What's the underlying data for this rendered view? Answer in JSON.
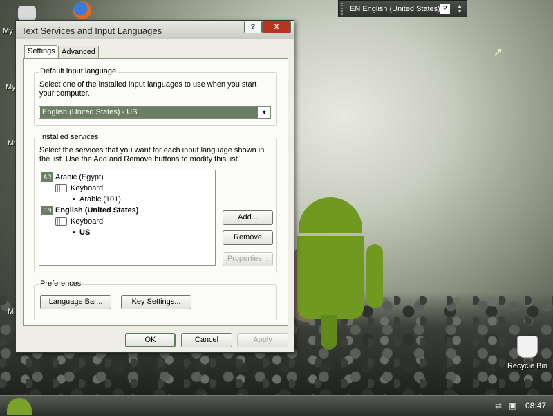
{
  "desktop": {
    "left_labels": [
      "My",
      "My",
      "My",
      "Mi"
    ],
    "recycle_bin": "Recycle Bin"
  },
  "language_bar": {
    "language": "EN English (United States)",
    "help": "?"
  },
  "dialog": {
    "title": "Text Services and Input Languages",
    "help_button": "?",
    "close_button": "X",
    "tabs": [
      {
        "label": "Settings"
      },
      {
        "label": "Advanced"
      }
    ],
    "default_input": {
      "title": "Default input language",
      "description": "Select one of the installed input languages to use when you start your computer.",
      "selected": "English (United States) - US"
    },
    "installed_services": {
      "title": "Installed services",
      "description": "Select the services that you want for each input language shown in the list. Use the Add and Remove buttons to modify this list.",
      "tree": {
        "lang1_badge": "AR",
        "lang1": "Arabic (Egypt)",
        "lang1_keyboard": "Keyboard",
        "lang1_layout": "Arabic (101)",
        "lang2_badge": "EN",
        "lang2": "English (United States)",
        "lang2_keyboard": "Keyboard",
        "lang2_layout": "US"
      },
      "buttons": {
        "add": "Add...",
        "remove": "Remove",
        "properties": "Properties..."
      }
    },
    "preferences": {
      "title": "Preferences",
      "language_bar": "Language Bar...",
      "key_settings": "Key Settings..."
    },
    "footer": {
      "ok": "OK",
      "cancel": "Cancel",
      "apply": "Apply"
    }
  },
  "taskbar": {
    "clock": "08:47"
  }
}
